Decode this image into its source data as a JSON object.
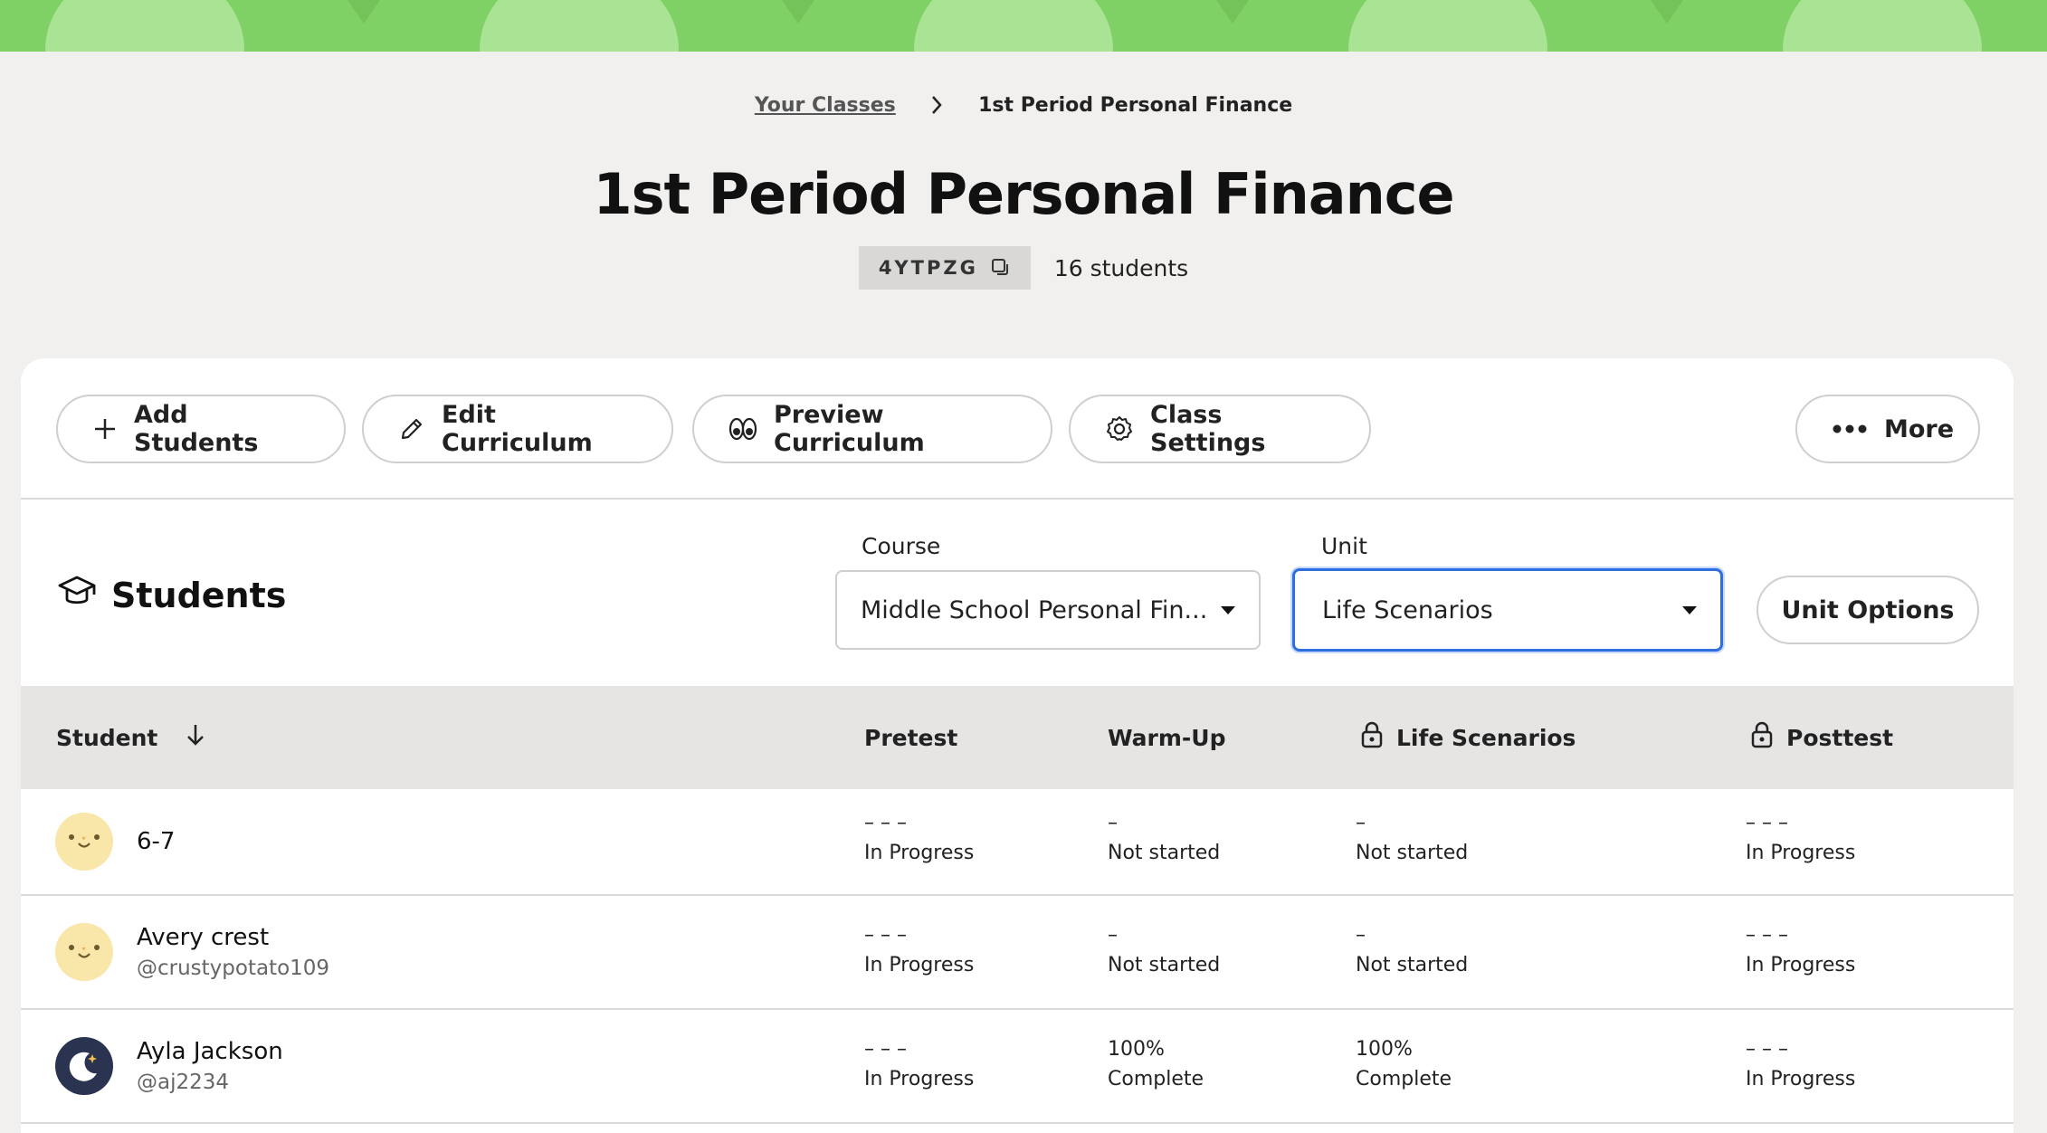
{
  "breadcrumb": {
    "parent": "Your Classes",
    "current": "1st Period Personal Finance"
  },
  "class": {
    "title": "1st Period Personal Finance",
    "code": "4YTPZG",
    "student_count": "16 students"
  },
  "toolbar": {
    "add_students": "Add Students",
    "edit_curriculum": "Edit Curriculum",
    "preview_curriculum": "Preview Curriculum",
    "class_settings": "Class Settings",
    "more": "More"
  },
  "students_section": {
    "title": "Students"
  },
  "filters": {
    "course_label": "Course",
    "course_value": "Middle School Personal Fin...",
    "unit_label": "Unit",
    "unit_value": "Life Scenarios",
    "unit_options": "Unit Options"
  },
  "table": {
    "headers": {
      "student": "Student",
      "pretest": "Pretest",
      "warmup": "Warm-Up",
      "life": "Life Scenarios",
      "posttest": "Posttest"
    },
    "rows": [
      {
        "name": "6-7",
        "handle": "",
        "avatar": "sun",
        "pretest": {
          "score": "– – –",
          "status": "In Progress"
        },
        "warmup": {
          "score": "–",
          "status": "Not started"
        },
        "life": {
          "score": "–",
          "status": "Not started"
        },
        "posttest": {
          "score": "– – –",
          "status": "In Progress"
        }
      },
      {
        "name": "Avery crest",
        "handle": "@crustypotato109",
        "avatar": "sun",
        "pretest": {
          "score": "– – –",
          "status": "In Progress"
        },
        "warmup": {
          "score": "–",
          "status": "Not started"
        },
        "life": {
          "score": "–",
          "status": "Not started"
        },
        "posttest": {
          "score": "– – –",
          "status": "In Progress"
        }
      },
      {
        "name": "Ayla Jackson",
        "handle": "@aj2234",
        "avatar": "moon",
        "pretest": {
          "score": "– – –",
          "status": "In Progress"
        },
        "warmup": {
          "score": "100%",
          "status": "Complete"
        },
        "life": {
          "score": "100%",
          "status": "Complete"
        },
        "posttest": {
          "score": "– – –",
          "status": "In Progress"
        }
      }
    ]
  }
}
